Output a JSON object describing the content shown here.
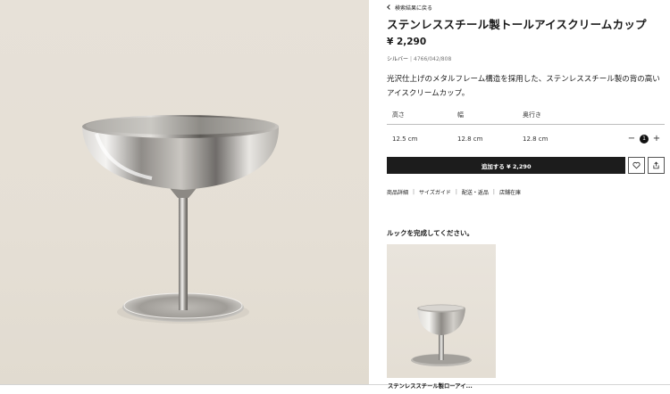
{
  "product": {
    "back_link": "検索結果に戻る",
    "title": "ステンレススチール製トールアイスクリームカップ",
    "price": "¥ 2,290",
    "color": "シルバー",
    "reference": "4766/042/808",
    "description": "光沢仕上げのメタルフレーム構造を採用した、ステンレススチール製の背の高いアイスクリームカップ。"
  },
  "dimensions": {
    "headers": [
      "高さ",
      "幅",
      "奥行き"
    ],
    "values": [
      "12.5 cm",
      "12.8 cm",
      "12.8 cm"
    ]
  },
  "quantity": {
    "minus": "−",
    "value": "1",
    "plus": "+"
  },
  "actions": {
    "add_to_cart": "追加する ¥ 2,290",
    "favorite_icon": "heart-icon",
    "share_icon": "share-icon"
  },
  "info_links": [
    "商品詳細",
    "サイズガイド",
    "配送・返品",
    "店舗在庫"
  ],
  "complete_look": {
    "heading": "ルックを完成してください。",
    "item_caption": "ステンレススチール製ローアイ..."
  },
  "colors": {
    "button_bg": "#1c1c1c",
    "photo_bg": "#e6e0d7"
  }
}
